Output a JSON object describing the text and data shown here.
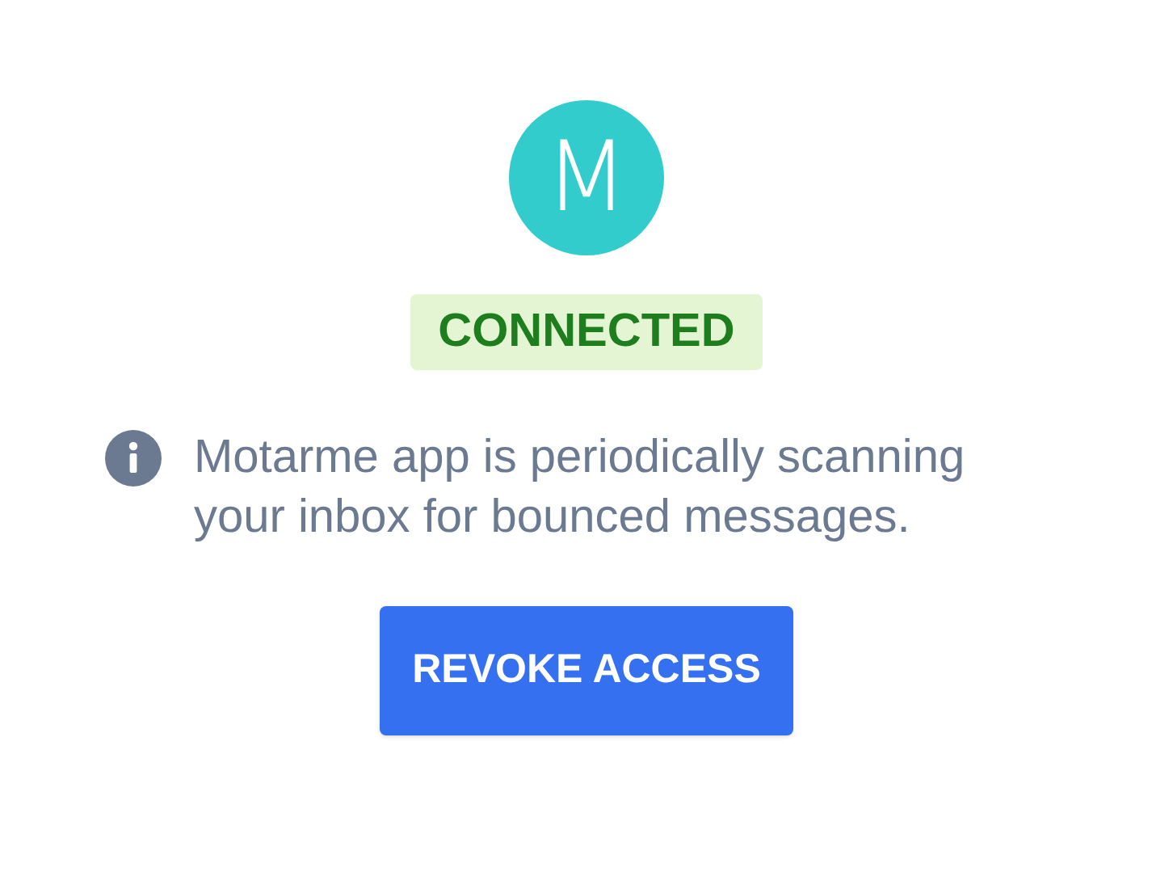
{
  "logo": {
    "letter": "M"
  },
  "status": {
    "label": "CONNECTED",
    "connected": true
  },
  "info": {
    "text": "Motarme app is periodically scanning your inbox for bounced messages."
  },
  "button": {
    "label": "REVOKE ACCESS"
  }
}
